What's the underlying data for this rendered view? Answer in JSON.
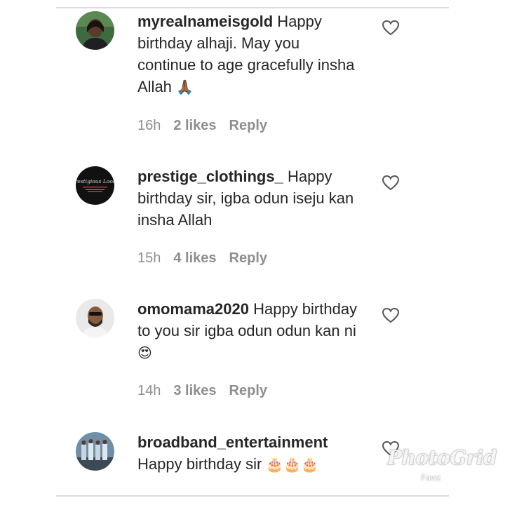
{
  "comments": [
    {
      "username": "myrealnameisgold",
      "text": " Happy birthday alhaji. May you continue to age gracefully insha Allah ",
      "emoji": "🙏🏾",
      "time": "16h",
      "likes": "2 likes",
      "reply": "Reply",
      "avatar_icon": "woman-portrait"
    },
    {
      "username": "prestige_clothings_",
      "text": " Happy birthday sir, igba odun iseju kan insha Allah",
      "emoji": "",
      "time": "15h",
      "likes": "4 likes",
      "reply": "Reply",
      "avatar_icon": "brand-logo",
      "avatar_text": "Prestigious Looks"
    },
    {
      "username": "omomama2020",
      "text": " Happy birthday to you sir igba odun odun kan ni ",
      "emoji": "😍",
      "time": "14h",
      "likes": "3 likes",
      "reply": "Reply",
      "avatar_icon": "man-with-sunglasses"
    },
    {
      "username": "broadband_entertainment",
      "text": " Happy birthday sir ",
      "emoji": "🎂🎂🎂",
      "time": "",
      "likes": "",
      "reply": "",
      "avatar_icon": "group-photo"
    }
  ],
  "watermark": {
    "text": "PhotoGrid",
    "sub": "Fawz"
  },
  "colors": {
    "text": "#262626",
    "meta": "#8e8e8e",
    "divider": "#dcdcdc"
  }
}
